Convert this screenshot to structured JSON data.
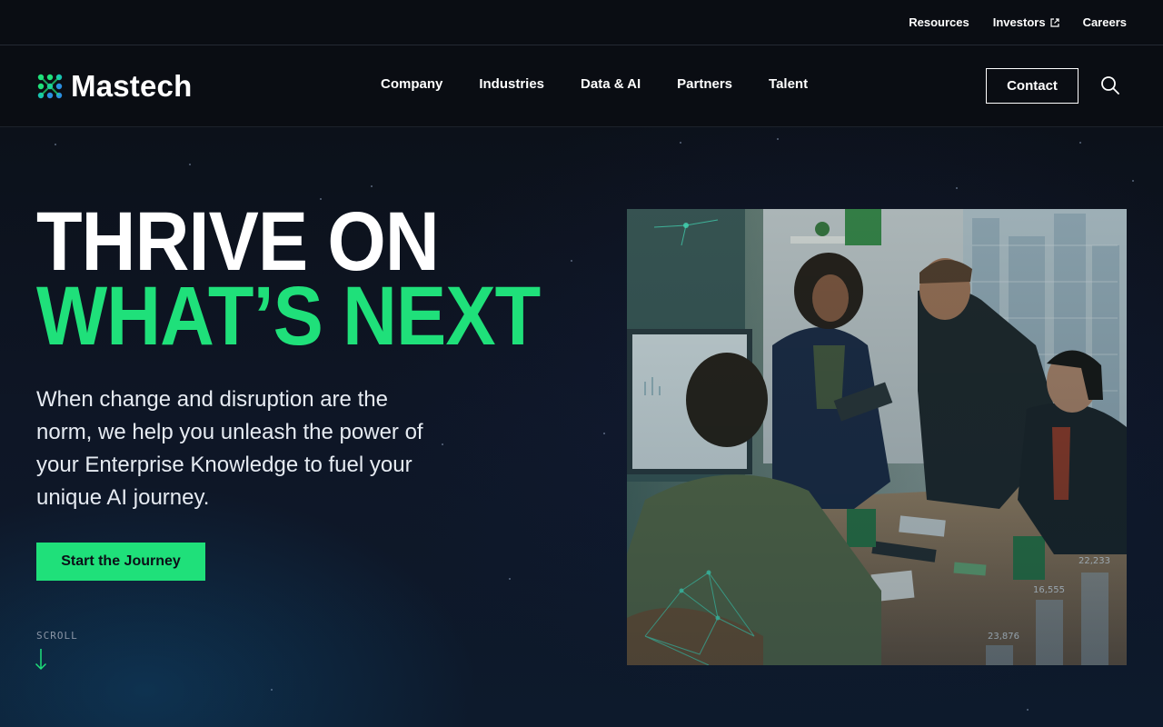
{
  "topbar": {
    "links": [
      "Resources",
      "Investors",
      "Careers"
    ]
  },
  "brand": {
    "name": "Mastech",
    "accent": "#1fe07a"
  },
  "nav": {
    "items": [
      "Company",
      "Industries",
      "Data & AI",
      "Partners",
      "Talent"
    ],
    "contact_label": "Contact"
  },
  "hero": {
    "line1": "THRIVE ON",
    "line2": "WHAT’S NEXT",
    "subtext": "When change and disruption are the norm, we help you unleash the power of your Enterprise Knowledge to fuel your unique AI journey.",
    "cta_label": "Start the Journey",
    "scroll_label": "SCROLL"
  },
  "photo": {
    "overlay_numbers": [
      "22,233",
      "16,555",
      "23,876"
    ]
  },
  "colors": {
    "background": "#0b0f17",
    "accent_green": "#1fe07a",
    "text": "#ffffff"
  },
  "icons": [
    "external-link-icon",
    "search-icon",
    "arrow-down-icon",
    "logo-mark-icon"
  ]
}
